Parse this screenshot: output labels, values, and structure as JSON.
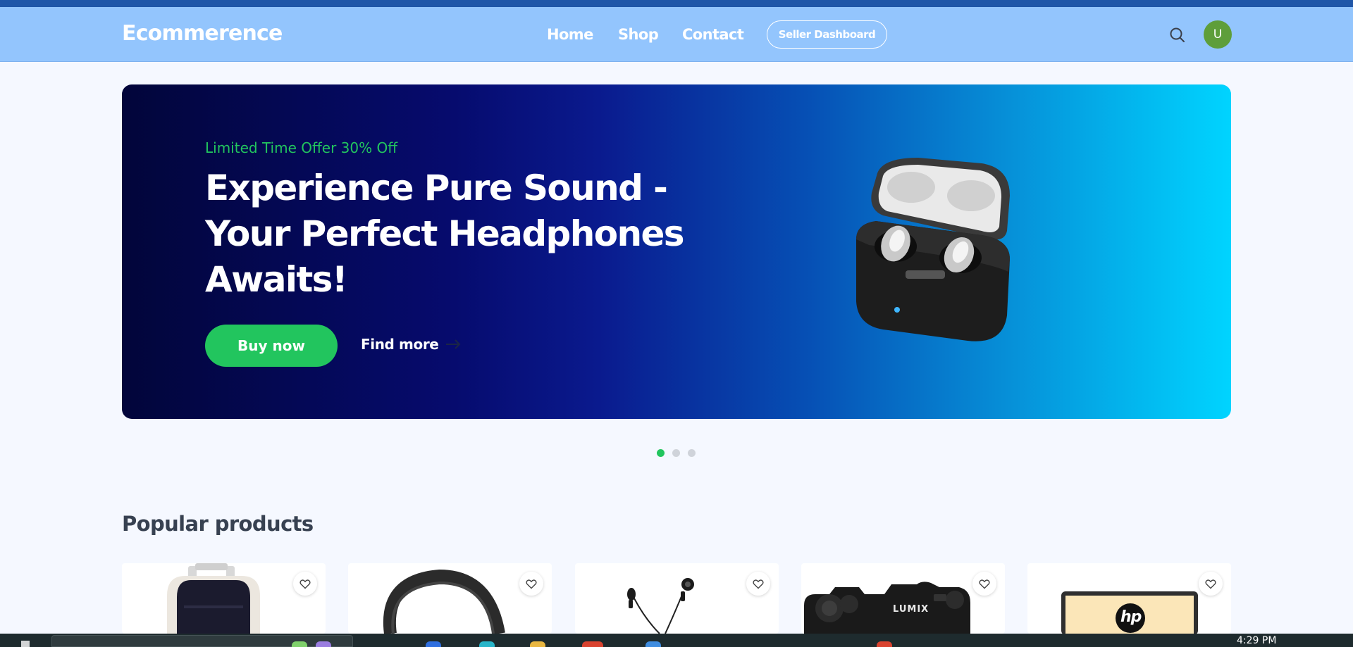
{
  "navbar": {
    "logo": "Ecommerence",
    "links": [
      "Home",
      "Shop",
      "Contact"
    ],
    "seller_button": "Seller Dashboard",
    "avatar_initial": "U",
    "search_icon": "search-icon"
  },
  "hero": {
    "offer": "Limited Time Offer 30% Off",
    "title": "Experience Pure Sound - Your Perfect Headphones Awaits!",
    "buy_button": "Buy now",
    "find_more": "Find more",
    "slide_count": 3,
    "active_slide": 1
  },
  "products": {
    "title": "Popular products",
    "items": [
      {
        "image": "backpack"
      },
      {
        "image": "headphones"
      },
      {
        "image": "earphones"
      },
      {
        "image": "camera",
        "brand": "LUMIX"
      },
      {
        "image": "laptop",
        "brand": "hp"
      }
    ]
  },
  "taskbar": {
    "time": "4:29 PM"
  },
  "colors": {
    "accent": "#22c55e",
    "navbar": "#93c5fd",
    "avatar": "#5e9e3a"
  }
}
